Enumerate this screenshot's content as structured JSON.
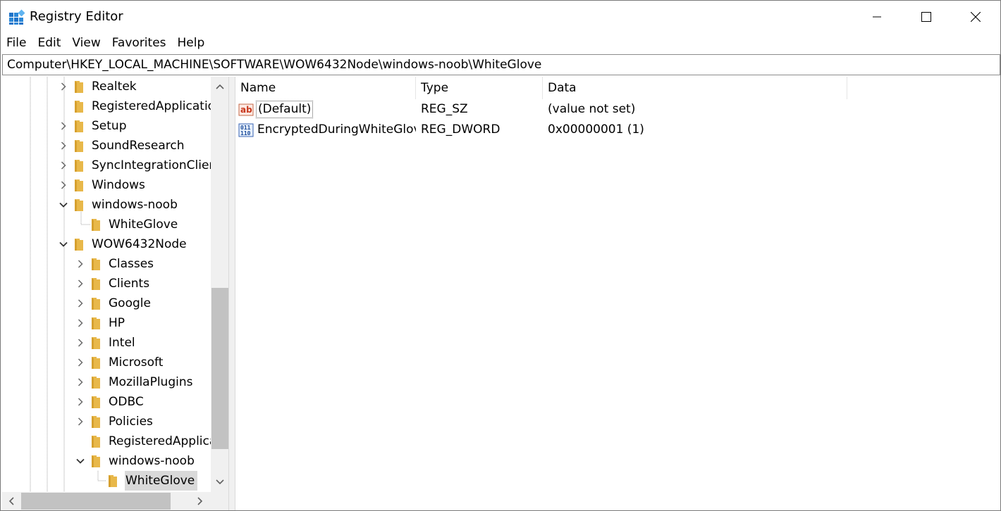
{
  "window": {
    "title": "Registry Editor",
    "icon": "registry-editor-icon"
  },
  "menu": [
    "File",
    "Edit",
    "View",
    "Favorites",
    "Help"
  ],
  "address": "Computer\\HKEY_LOCAL_MACHINE\\SOFTWARE\\WOW6432Node\\windows-noob\\WhiteGlove",
  "tree": [
    {
      "label": "Realtek",
      "expander": "collapsed",
      "level": 0
    },
    {
      "label": "RegisteredApplications",
      "expander": "none",
      "level": 0
    },
    {
      "label": "Setup",
      "expander": "collapsed",
      "level": 0
    },
    {
      "label": "SoundResearch",
      "expander": "collapsed",
      "level": 0
    },
    {
      "label": "SyncIntegrationClients",
      "expander": "collapsed",
      "level": 0
    },
    {
      "label": "Windows",
      "expander": "collapsed",
      "level": 0
    },
    {
      "label": "windows-noob",
      "expander": "expanded",
      "level": 0
    },
    {
      "label": "WhiteGlove",
      "expander": "none",
      "level": 1
    },
    {
      "label": "WOW6432Node",
      "expander": "expanded",
      "level": 0
    },
    {
      "label": "Classes",
      "expander": "collapsed",
      "level": 1
    },
    {
      "label": "Clients",
      "expander": "collapsed",
      "level": 1
    },
    {
      "label": "Google",
      "expander": "collapsed",
      "level": 1
    },
    {
      "label": "HP",
      "expander": "collapsed",
      "level": 1
    },
    {
      "label": "Intel",
      "expander": "collapsed",
      "level": 1
    },
    {
      "label": "Microsoft",
      "expander": "collapsed",
      "level": 1
    },
    {
      "label": "MozillaPlugins",
      "expander": "collapsed",
      "level": 1
    },
    {
      "label": "ODBC",
      "expander": "collapsed",
      "level": 1
    },
    {
      "label": "Policies",
      "expander": "collapsed",
      "level": 1
    },
    {
      "label": "RegisteredApplications",
      "expander": "none",
      "level": 1
    },
    {
      "label": "windows-noob",
      "expander": "expanded",
      "level": 1
    },
    {
      "label": "WhiteGlove",
      "expander": "none",
      "level": 2,
      "selected": true
    }
  ],
  "list": {
    "columns": {
      "name": "Name",
      "type": "Type",
      "data": "Data"
    },
    "rows": [
      {
        "name": "(Default)",
        "type": "REG_SZ",
        "data": "(value not set)",
        "icon": "string-value-icon",
        "focused": true
      },
      {
        "name": "EncryptedDuringWhiteGlove",
        "type": "REG_DWORD",
        "data": "0x00000001 (1)",
        "icon": "binary-value-icon",
        "focused": false
      }
    ]
  },
  "colors": {
    "folder": "#e8b84a",
    "folder_dark": "#d6a02e",
    "selection": "#d9d9d9",
    "accent": "#0078d7"
  }
}
